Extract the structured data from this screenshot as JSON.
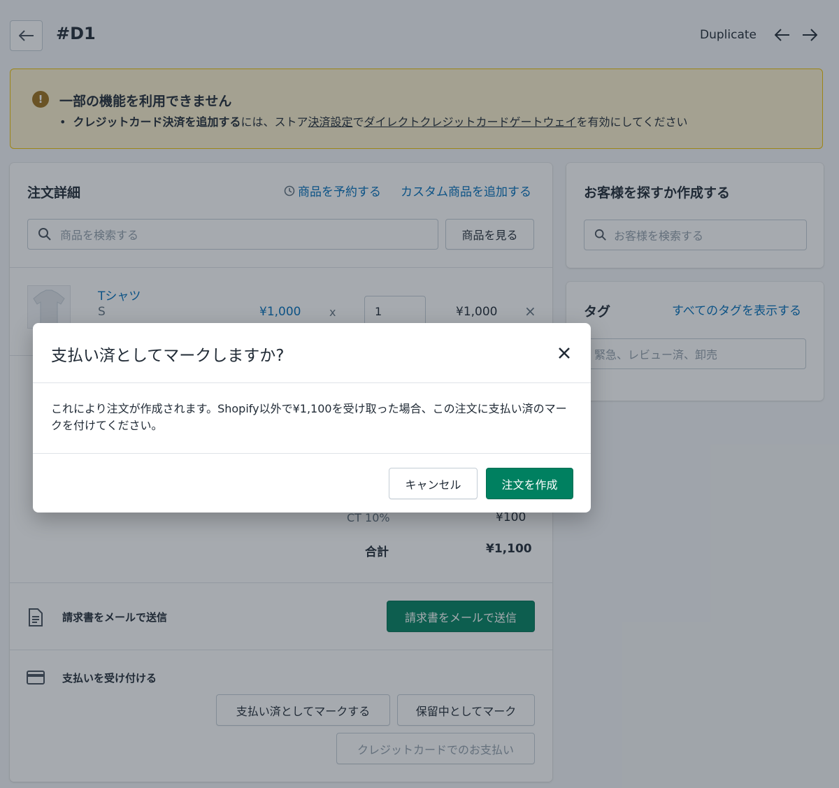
{
  "header": {
    "title": "#D1",
    "duplicate_label": "Duplicate"
  },
  "banner": {
    "title": "一部の機能を利用できません",
    "icon": "!",
    "bold_text": "クレジットカード決済を追加する",
    "text_1": "には、ストア",
    "link_1": "決済設定",
    "text_2": "で",
    "link_2": "ダイレクトクレジットカードゲートウェイ",
    "text_3": "を有効にしてください"
  },
  "order": {
    "title": "注文詳細",
    "reserve_link": "商品を予約する",
    "custom_link": "カスタム商品を追加する",
    "search_placeholder": "商品を検索する",
    "browse_button": "商品を見る",
    "item": {
      "name": "Tシャツ",
      "variant": "S",
      "price": "¥1,000",
      "times": "x",
      "quantity": "1",
      "total": "¥1,000",
      "remove": "×"
    },
    "tax_label": "CT 10%",
    "tax_value": "¥100",
    "total_label": "合計",
    "total_value": "¥1,100",
    "invoice_label": "請求書をメールで送信",
    "invoice_button": "請求書をメールで送信",
    "payment_label": "支払いを受け付ける",
    "mark_paid_button": "支払い済としてマークする",
    "mark_pending_button": "保留中としてマーク",
    "credit_card_button": "クレジットカードでのお支払い"
  },
  "customer": {
    "title": "お客様を探すか作成する",
    "search_placeholder": "お客様を検索する"
  },
  "tags": {
    "title": "タグ",
    "view_all": "すべてのタグを表示する",
    "placeholder": "緊急、レビュー済、卸売"
  },
  "modal": {
    "title": "支払い済としてマークしますか?",
    "body": "これにより注文が作成されます。Shopify以外で¥1,100を受け取った場合、この注文に支払い済のマークを付けてください。",
    "cancel": "キャンセル",
    "confirm": "注文を作成"
  },
  "colors": {
    "primary": "#008060",
    "link": "#006fbb",
    "warning_bg": "#fcf1cd"
  }
}
